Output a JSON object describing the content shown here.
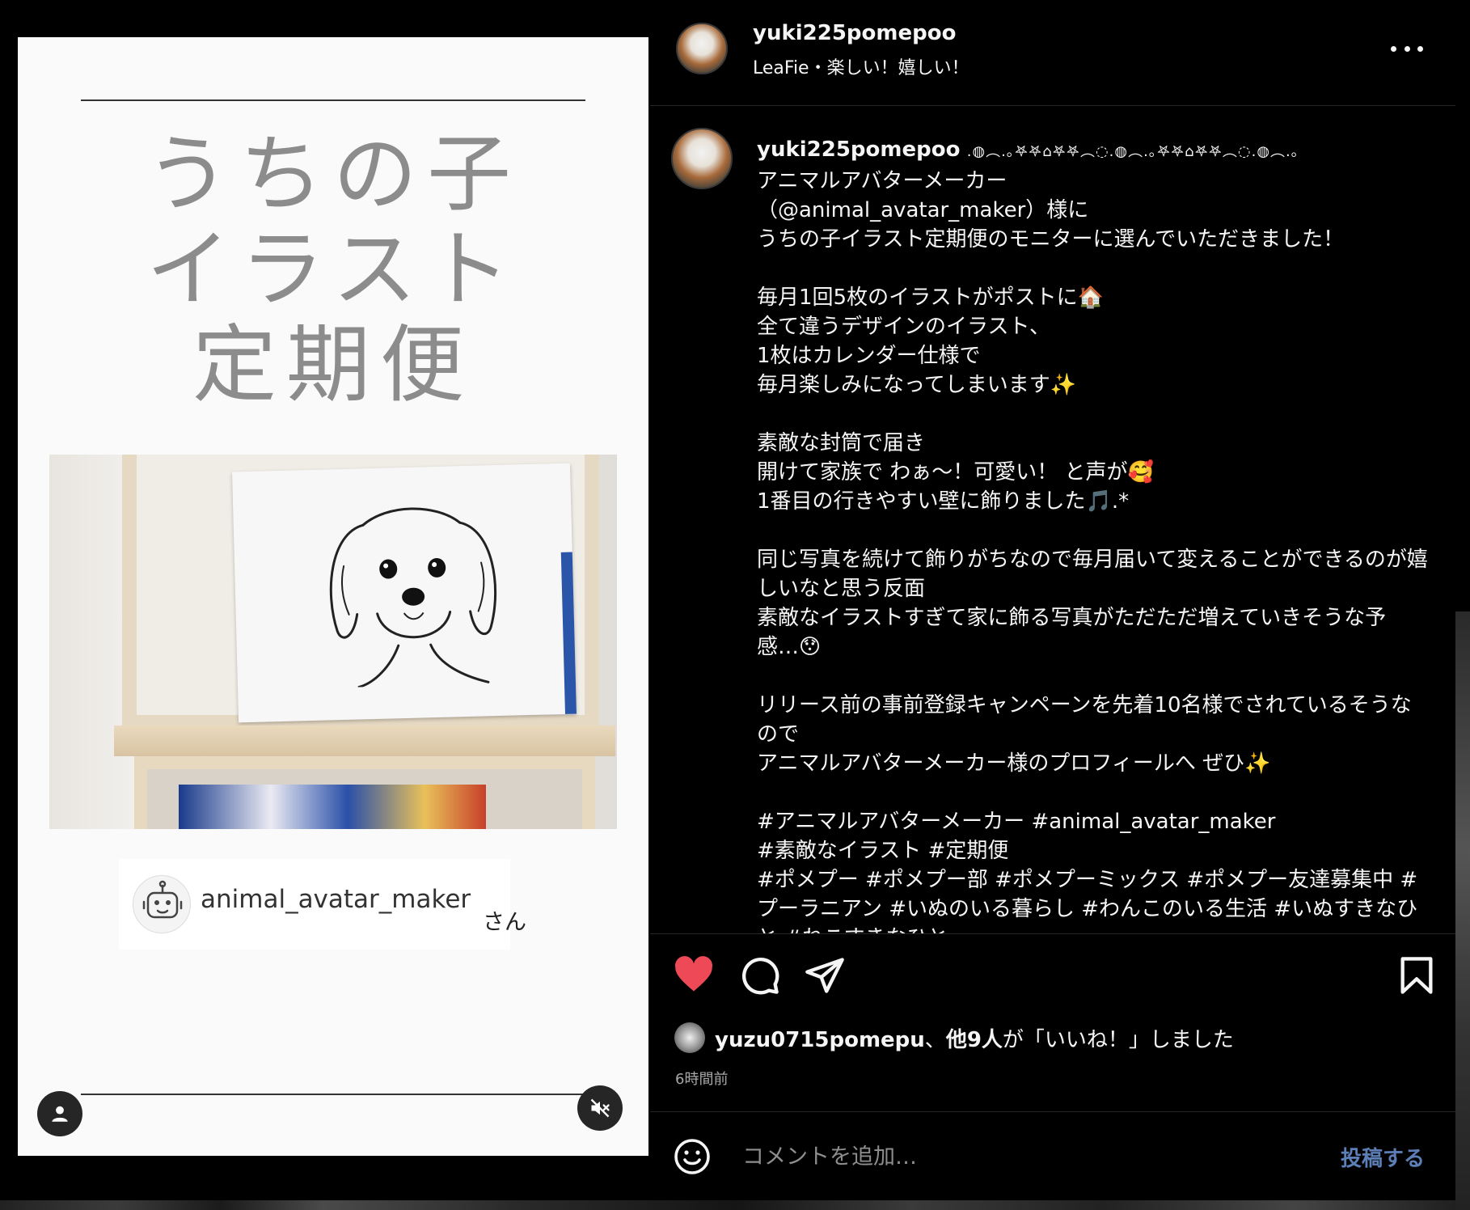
{
  "media": {
    "title": "うちの子\nイラスト\n定期便",
    "credit_handle": "animal_avatar_maker",
    "credit_suffix": "さん",
    "icons": {
      "profile": "person-icon",
      "mute": "muted-speaker-icon",
      "credit": "robot-icon"
    }
  },
  "header": {
    "username": "yuki225pomepoo",
    "subtitle": "LeaFie・楽しい！嬉しい！",
    "more_icon": "more-horizontal-icon"
  },
  "caption": {
    "username": "yuki225pomepoo",
    "decoration": ".◍︵.｡𖤐𖤐⌂𖤐𖤐︵◌.◍︵.｡𖤐𖤐⌂𖤐𖤐︵◌.◍︵.｡",
    "body": "アニマルアバターメーカー\n（@animal_avatar_maker）様に\nうちの子イラスト定期便のモニターに選んでいただきました！\n\n毎月1回5枚のイラストがポストに🏠\n全て違うデザインのイラスト、\n1枚はカレンダー仕様で\n毎月楽しみになってしまいます✨\n\n素敵な封筒で届き\n開けて家族で わぁ〜！可愛い！ と声が🥰\n1番目の行きやすい壁に飾りました🎵.*\n\n同じ写真を続けて飾りがちなので毎月届いて変えることができるのが嬉しいなと思う反面\n素敵なイラストすぎて家に飾る写真がただただ増えていきそうな予感…😯\n\nリリース前の事前登録キャンペーンを先着10名様でされているそうなので\nアニマルアバターメーカー様のプロフィールへ ぜひ✨\n\n#アニマルアバターメーカー #animal_avatar_maker\n#素敵なイラスト #定期便\n#ポメプー #ポメプー部 #ポメプーミックス #ポメプー友達募集中 #プーラニアン #いぬのいる暮らし #わんこのいる生活 #いぬすきなひと #ねこすきなひと"
  },
  "actions": {
    "icons": [
      "heart-icon",
      "comment-icon",
      "share-icon",
      "bookmark-icon"
    ],
    "liked": true,
    "like_color": "#ed4956",
    "likes_user": "yuzu0715pomepu",
    "likes_sep": "、",
    "likes_count": "他9人",
    "likes_suffix": "が「いいね！」しました",
    "timestamp": "6時間前"
  },
  "comment": {
    "placeholder": "コメントを追加…",
    "post_label": "投稿する",
    "post_color": "#5b7fb6",
    "emoji_icon": "smiley-icon"
  }
}
